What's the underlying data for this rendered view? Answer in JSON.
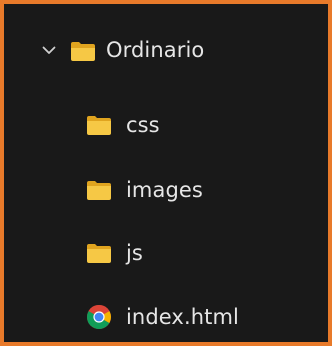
{
  "tree": {
    "root": {
      "label": "Ordinario",
      "icon": "folder-open-icon",
      "expanded": true
    },
    "items": [
      {
        "label": "css",
        "icon": "folder-icon"
      },
      {
        "label": "images",
        "icon": "folder-icon"
      },
      {
        "label": "js",
        "icon": "folder-icon"
      },
      {
        "label": "index.html",
        "icon": "chrome-icon"
      }
    ]
  },
  "colors": {
    "frame_border": "#e87a2a",
    "background": "#191919",
    "text": "#e6e6e6",
    "folder": "#f2c12e"
  }
}
